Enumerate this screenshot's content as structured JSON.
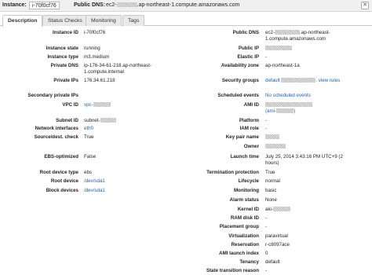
{
  "header": {
    "instance_label": "Instance:",
    "instance_id": "i-70f0cf76",
    "public_dns_label": "Public DNS:",
    "public_dns_prefix": "ec2-",
    "public_dns_suffix": ".ap-northeast-1.compute.amazonaws.com"
  },
  "tabs": [
    {
      "label": "Description",
      "active": true
    },
    {
      "label": "Status Checks",
      "active": false
    },
    {
      "label": "Monitoring",
      "active": false
    },
    {
      "label": "Tags",
      "active": false
    }
  ],
  "left": {
    "instance_id": {
      "label": "Instance ID",
      "value": "i-70f0cf76"
    },
    "instance_state": {
      "label": "Instance state",
      "value": "running"
    },
    "instance_type": {
      "label": "Instance type",
      "value": "m3.medium"
    },
    "private_dns": {
      "label": "Private DNS",
      "value_line1": "ip-176-34-61-218.ap-northeast-",
      "value_line2": "1.compute.internal"
    },
    "private_ips": {
      "label": "Private IPs",
      "value": "176.34.61.218"
    },
    "secondary_private_ips": {
      "label": "Secondary private IPs",
      "value": ""
    },
    "vpc_id": {
      "label": "VPC ID",
      "value": "vpc-"
    },
    "subnet_id": {
      "label": "Subnet ID",
      "value": "subnet-"
    },
    "network_interfaces": {
      "label": "Network interfaces",
      "value": "eth0"
    },
    "source_dest_check": {
      "label": "Source/dest. check",
      "value": "True"
    },
    "ebs_optimized": {
      "label": "EBS-optimized",
      "value": "False"
    },
    "root_device_type": {
      "label": "Root device type",
      "value": "ebs"
    },
    "root_device": {
      "label": "Root device",
      "value": "/dev/sda1"
    },
    "block_devices": {
      "label": "Block devices",
      "value": "/dev/sda1"
    }
  },
  "right": {
    "public_dns": {
      "label": "Public DNS",
      "value_line1_prefix": "ec2-",
      "value_line1_suffix": ".ap-northeast-",
      "value_line2": "1.compute.amazonaws.com"
    },
    "public_ip": {
      "label": "Public IP",
      "value": ""
    },
    "elastic_ip": {
      "label": "Elastic IP",
      "value": "-"
    },
    "availability_zone": {
      "label": "Availability zone",
      "value": "ap-northeast-1a"
    },
    "security_groups": {
      "label": "Security groups",
      "value": "default",
      "suffix": ". view rules"
    },
    "scheduled_events": {
      "label": "Scheduled events",
      "value": "No scheduled events"
    },
    "ami_id": {
      "label": "AMI ID",
      "value_line2_prefix": "(ami-",
      "value_line2_suffix": ")"
    },
    "platform": {
      "label": "Platform",
      "value": "-"
    },
    "iam_role": {
      "label": "IAM role",
      "value": "-"
    },
    "key_pair_name": {
      "label": "Key pair name",
      "value": ""
    },
    "owner": {
      "label": "Owner",
      "value": ""
    },
    "launch_time": {
      "label": "Launch time",
      "value_line1": "July 25, 2014 3:43:16 PM UTC+9 (2",
      "value_line2": "hours)"
    },
    "termination_protection": {
      "label": "Termination protection",
      "value": "True"
    },
    "lifecycle": {
      "label": "Lifecycle",
      "value": "normal"
    },
    "monitoring": {
      "label": "Monitoring",
      "value": "basic"
    },
    "alarm_status": {
      "label": "Alarm status",
      "value": "None"
    },
    "kernel_id": {
      "label": "Kernel ID",
      "value": "aki-"
    },
    "ram_disk_id": {
      "label": "RAM disk ID",
      "value": "-"
    },
    "placement_group": {
      "label": "Placement group",
      "value": "-"
    },
    "virtualization": {
      "label": "Virtualization",
      "value": "paravirtual"
    },
    "reservation": {
      "label": "Reservation",
      "value": "r-c8097ace"
    },
    "ami_launch_index": {
      "label": "AMI launch index",
      "value": "0"
    },
    "tenancy": {
      "label": "Tenancy",
      "value": "default"
    },
    "state_transition_reason": {
      "label": "State transition reason",
      "value": "-"
    }
  },
  "colors": {
    "link": "#2060b0",
    "topbar": "#f0f0f0",
    "tab_inactive": "#e9e9e9"
  },
  "icons": {
    "close": "close-icon"
  }
}
